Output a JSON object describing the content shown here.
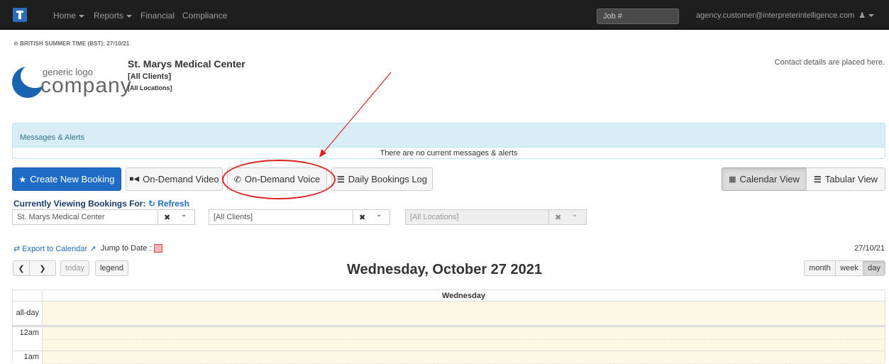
{
  "navbar": {
    "menu": [
      {
        "label": "Home",
        "has_caret": true
      },
      {
        "label": "Reports",
        "has_caret": true
      },
      {
        "label": "Financial",
        "has_caret": false
      },
      {
        "label": "Compliance",
        "has_caret": false
      }
    ],
    "job_placeholder": "Job #",
    "user_email": "agency.customer@interpreterintelligence.com"
  },
  "header": {
    "timezone": "⊙ BRITISH SUMMER TIME (BST): 27/10/21",
    "logo_small": "generic logo",
    "logo_big": "company",
    "org_name": "St. Marys Medical Center",
    "clients": "[All Clients]",
    "locations": "[All Locations]",
    "contact": "Contact details are placed here."
  },
  "alerts": {
    "heading": "Messages & Alerts",
    "body": "There are no current messages & alerts"
  },
  "actions": {
    "create": "Create New Booking",
    "video": "On-Demand Video",
    "voice": "On-Demand Voice",
    "daily_log": "Daily Bookings Log",
    "calendar_view": "Calendar View",
    "tabular_view": "Tabular View"
  },
  "filters": {
    "label": "Currently Viewing Bookings For:",
    "refresh": "Refresh",
    "org_value": "St. Marys Medical Center",
    "clients_value": "[All Clients]",
    "locations_value": "[All Locations]"
  },
  "calendar": {
    "export": "Export to Calendar",
    "jump_to_date": "Jump to Date :",
    "date_short": "27/10/21",
    "today": "today",
    "legend": "legend",
    "title": "Wednesday, October 27 2021",
    "views": {
      "month": "month",
      "week": "week",
      "day": "day"
    },
    "day_header": "Wednesday",
    "rows": {
      "allday": "all-day",
      "h12am": "12am",
      "h1am": "1am"
    }
  },
  "colors": {
    "primary": "#1e6cc4",
    "navbar": "#1e1e1e",
    "alert_bg": "#d9edf7",
    "highlight": "#d22222",
    "today_cell": "#fcf8e3"
  }
}
